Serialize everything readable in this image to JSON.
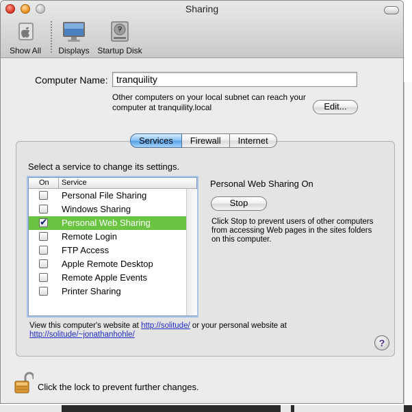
{
  "window": {
    "title": "Sharing"
  },
  "toolbar": {
    "items": [
      {
        "label": "Show All",
        "icon": "apple-logo-icon"
      },
      {
        "label": "Displays",
        "icon": "display-icon"
      },
      {
        "label": "Startup Disk",
        "icon": "hard-disk-icon"
      }
    ]
  },
  "computer_name": {
    "label": "Computer Name:",
    "value": "tranquility",
    "info": "Other computers on your local subnet can reach your computer at tranquility.local",
    "edit_label": "Edit..."
  },
  "tabs": [
    {
      "label": "Services",
      "active": true
    },
    {
      "label": "Firewall",
      "active": false
    },
    {
      "label": "Internet",
      "active": false
    }
  ],
  "services": {
    "instruction": "Select a service to change its settings.",
    "col_on": "On",
    "col_service": "Service",
    "items": [
      {
        "name": "Personal File Sharing",
        "on": false,
        "selected": false
      },
      {
        "name": "Windows Sharing",
        "on": false,
        "selected": false
      },
      {
        "name": "Personal Web Sharing",
        "on": true,
        "selected": true
      },
      {
        "name": "Remote Login",
        "on": false,
        "selected": false
      },
      {
        "name": "FTP Access",
        "on": false,
        "selected": false
      },
      {
        "name": "Apple Remote Desktop",
        "on": false,
        "selected": false
      },
      {
        "name": "Remote Apple Events",
        "on": false,
        "selected": false
      },
      {
        "name": "Printer Sharing",
        "on": false,
        "selected": false
      }
    ]
  },
  "status": {
    "title": "Personal Web Sharing On",
    "button_label": "Stop",
    "description": "Click Stop to prevent users of other computers from accessing Web pages in the sites folders on this computer."
  },
  "footer": {
    "prefix": "View this computer's website at ",
    "link1": "http://solitude/",
    "middle": " or your personal website at ",
    "link2": "http://solitude/~jonathanhohle/",
    "help": "?"
  },
  "lock": {
    "text": "Click the lock to prevent further changes."
  },
  "colors": {
    "selection": "#6ac442",
    "tab_active": "#5aa2e8",
    "link": "#1d2bc4"
  }
}
